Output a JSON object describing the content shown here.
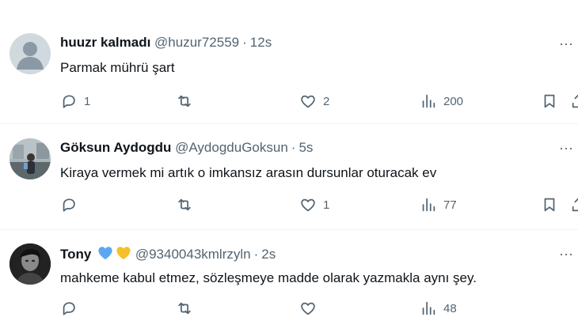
{
  "replies": [
    {
      "name": "huuzr kalmadı",
      "handle": "@huzur72559",
      "dot": "·",
      "time": "12s",
      "text": "Parmak mührü şart",
      "reply_count": "1",
      "repost_count": "",
      "like_count": "2",
      "view_count": "200",
      "avatar": "default-avatar"
    },
    {
      "name": "Göksun Aydogdu",
      "handle": "@AydogduGoksun",
      "dot": "·",
      "time": "5s",
      "text": "Kiraya vermek mi artık o imkansız arasın dursunlar oturacak ev",
      "reply_count": "",
      "repost_count": "",
      "like_count": "1",
      "view_count": "77",
      "avatar": "photo-avatar"
    },
    {
      "name": "Tony",
      "handle": "@9340043kmlrzyln",
      "dot": "·",
      "time": "2s",
      "text": "mahkeme kabul etmez, sözleşmeye madde olarak yazmakla aynı şey.",
      "reply_count": "",
      "repost_count": "",
      "like_count": "",
      "view_count": "48",
      "avatar": "photo-avatar",
      "name_badges": [
        "blue-heart",
        "yellow-heart"
      ]
    }
  ],
  "colors": {
    "text_primary": "#0f1419",
    "text_secondary": "#536471",
    "divider": "#eff3f4",
    "blue_heart": "#5aa8f0",
    "yellow_heart": "#f5c02b"
  }
}
